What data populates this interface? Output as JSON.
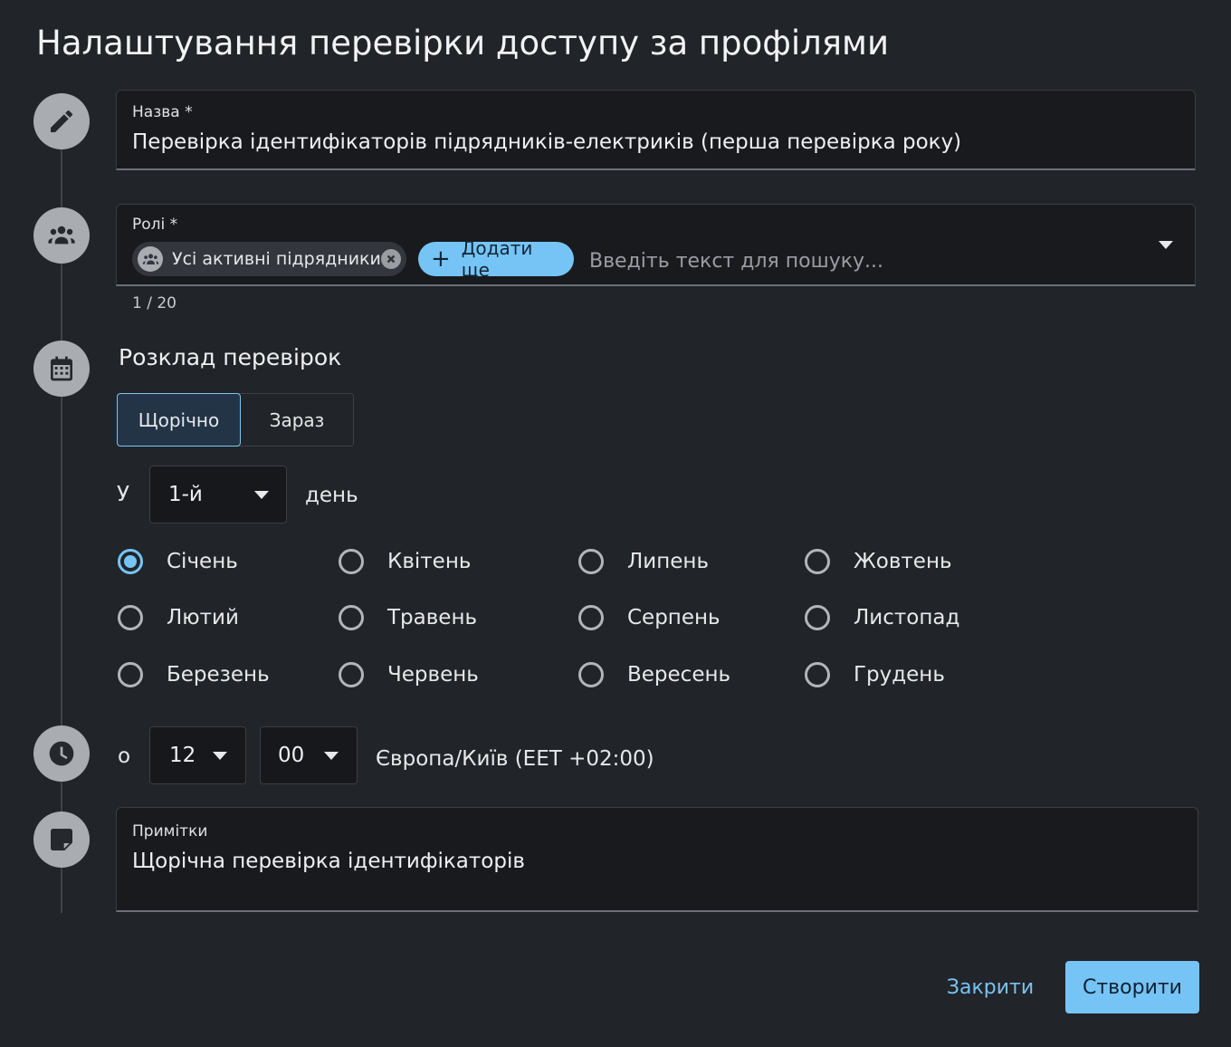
{
  "title": "Налаштування перевірки доступу за профілями",
  "name_field": {
    "label": "Назва *",
    "value": "Перевірка ідентифікаторів підрядників-електриків (перша перевірка року)"
  },
  "roles_field": {
    "label": "Ролі *",
    "chip_label": "Усі активні підрядники",
    "add_button": "Додати ще",
    "search_placeholder": "Введіть текст для пошуку...",
    "counter": "1 / 20"
  },
  "schedule": {
    "title": "Розклад перевірок",
    "toggle_yearly": "Щорічно",
    "toggle_now": "Зараз",
    "day_prefix": "У",
    "day_value": "1-й",
    "day_suffix": "день",
    "months": {
      "jan": "Січень",
      "feb": "Лютий",
      "mar": "Березень",
      "apr": "Квітень",
      "may": "Травень",
      "jun": "Червень",
      "jul": "Липень",
      "aug": "Серпень",
      "sep": "Вересень",
      "oct": "Жовтень",
      "nov": "Листопад",
      "dec": "Грудень"
    },
    "selected_month": "Січень"
  },
  "time": {
    "prefix": "о",
    "hour": "12",
    "minute": "00",
    "timezone": "Європа/Київ (EET +02:00)"
  },
  "notes": {
    "label": "Примітки",
    "value": "Щорічна перевірка ідентифікаторів"
  },
  "actions": {
    "close": "Закрити",
    "create": "Створити"
  },
  "colors": {
    "background": "#212429",
    "accent": "#76c4f6",
    "field_bg": "#181a1e"
  }
}
